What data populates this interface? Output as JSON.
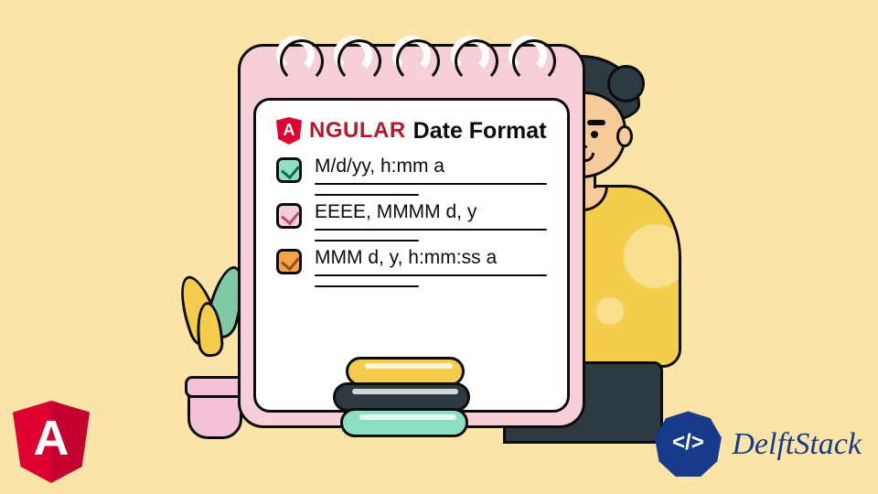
{
  "title": {
    "angular_text": "NGULAR",
    "rest": "Date Format"
  },
  "items": [
    {
      "color": "green",
      "format": "M/d/yy, h:mm a"
    },
    {
      "color": "pink",
      "format": "EEEE, MMMM d, y"
    },
    {
      "color": "orange",
      "format": "MMM d, y, h:mm:ss a"
    }
  ],
  "brand": {
    "name": "DelftStack",
    "code_glyph": "</>"
  },
  "colors": {
    "background": "#fae4a7",
    "angular_red": "#dd0031",
    "delft_blue": "#173a8a",
    "shirt": "#f5cd4d",
    "pad_pink": "#f7cfd9"
  }
}
